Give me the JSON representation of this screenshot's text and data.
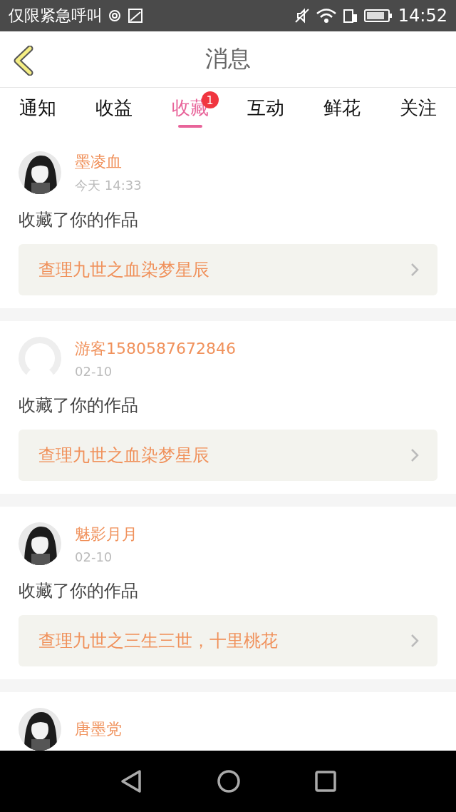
{
  "status_bar": {
    "carrier": "仅限紧急呼叫",
    "time": "14:52"
  },
  "header": {
    "title": "消息"
  },
  "tabs": [
    {
      "label": "通知",
      "selected": false
    },
    {
      "label": "收益",
      "selected": false
    },
    {
      "label": "收藏",
      "selected": true,
      "badge": "1"
    },
    {
      "label": "互动",
      "selected": false
    },
    {
      "label": "鲜花",
      "selected": false
    },
    {
      "label": "关注",
      "selected": false
    }
  ],
  "messages": [
    {
      "user": "墨凌血",
      "time": "今天 14:33",
      "text": "收藏了你的作品",
      "work": "查理九世之血染梦星辰"
    },
    {
      "user": "游客1580587672846",
      "avatar": {
        "kind": "default"
      },
      "time": "02-10",
      "text": "收藏了你的作品",
      "work": "查理九世之血染梦星辰"
    },
    {
      "user": "魅影月月",
      "time": "02-10",
      "text": "收藏了你的作品",
      "work": "查理九世之三生三世，十里桃花"
    },
    {
      "user": "唐墨党"
    }
  ]
}
